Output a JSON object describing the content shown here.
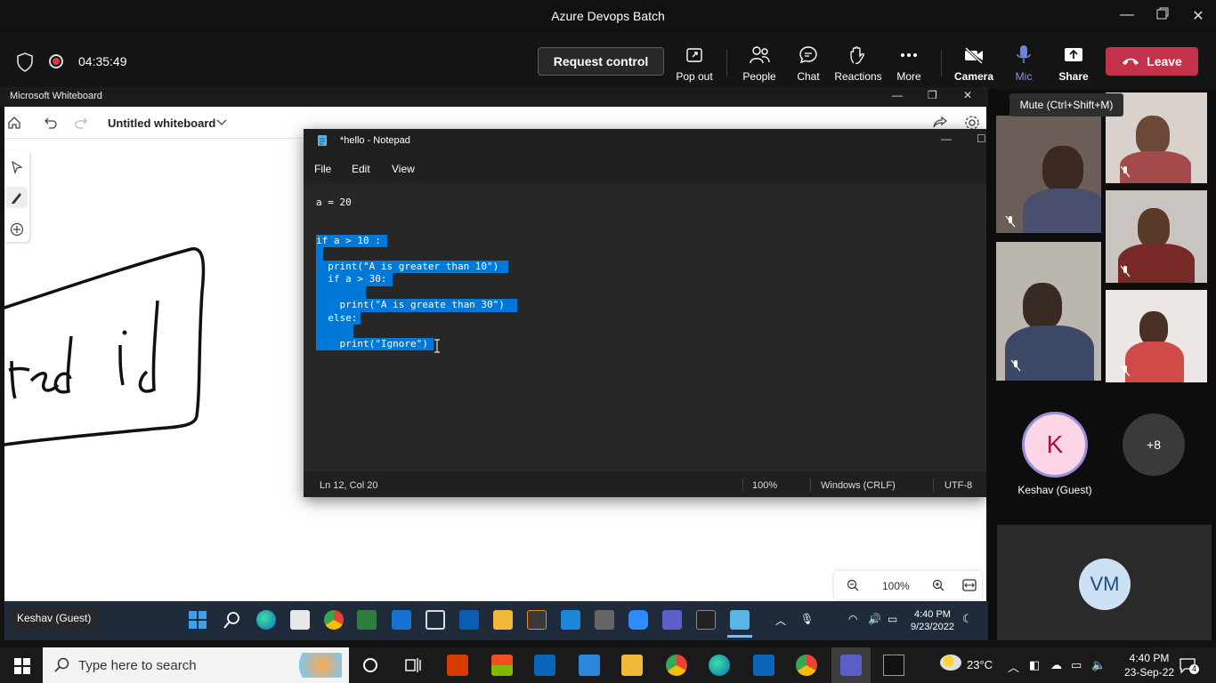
{
  "window": {
    "title": "Azure Devops Batch"
  },
  "meeting": {
    "timer": "04:35:49",
    "request_control": "Request control",
    "buttons": {
      "popout": "Pop out",
      "people": "People",
      "chat": "Chat",
      "reactions": "Reactions",
      "more": "More",
      "camera": "Camera",
      "mic": "Mic",
      "share": "Share"
    },
    "leave": "Leave",
    "mic_tooltip": "Mute (Ctrl+Shift+M)"
  },
  "whiteboard": {
    "app_title": "Microsoft Whiteboard",
    "doc_title": "Untitled whiteboard",
    "zoom": "100%",
    "ink_text": "ted i d"
  },
  "notepad": {
    "title": "*hello - Notepad",
    "menu": [
      "File",
      "Edit",
      "View"
    ],
    "lines": [
      "a = 20",
      "",
      "if a > 10 :",
      "",
      "  print(\"A is greater than 10\")",
      "  if a > 30:",
      "",
      "    print(\"A is greate than 30\")",
      "  else:",
      "",
      "    print(\"Ignore\")"
    ],
    "status": {
      "position": "Ln 12, Col 20",
      "zoom": "100%",
      "eol": "Windows (CRLF)",
      "encoding": "UTF-8"
    }
  },
  "shared_taskbar": {
    "presenter": "Keshav (Guest)",
    "time": "4:40 PM",
    "date": "9/23/2022"
  },
  "participants": {
    "keshav_initial": "K",
    "keshav_name": "Keshav (Guest)",
    "more": "+8",
    "vm_initials": "VM"
  },
  "taskbar": {
    "search_placeholder": "Type here to search",
    "weather": "23°C",
    "time": "4:40 PM",
    "date": "23-Sep-22",
    "notifications": "4"
  },
  "colors": {
    "leave_red": "#c4314b",
    "selection_blue": "#0078d7",
    "mic_accent": "#6f83d9"
  }
}
